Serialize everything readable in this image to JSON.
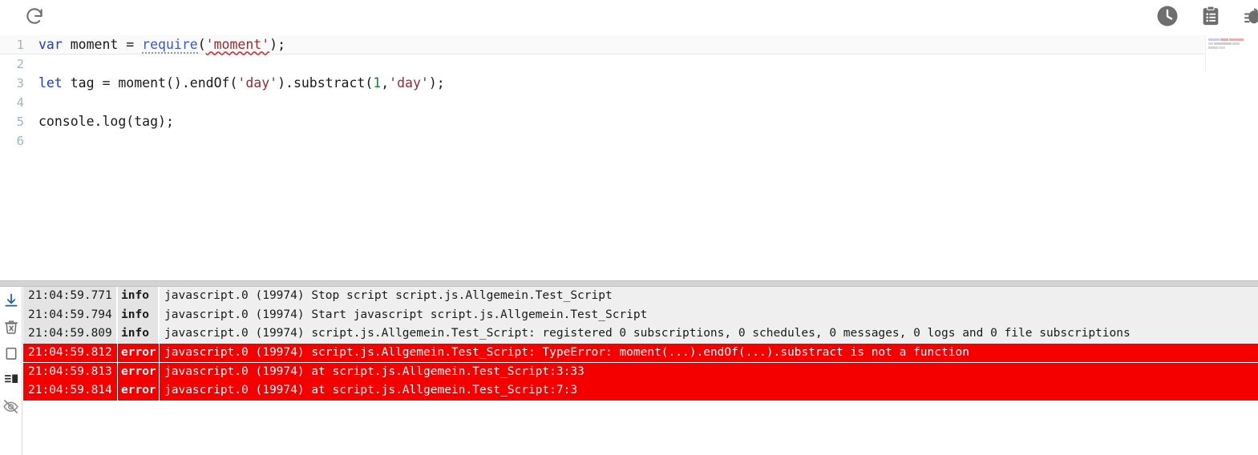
{
  "toolbar": {
    "left_icons": [
      {
        "name": "reload-icon",
        "label": "Reload"
      }
    ],
    "right_icons": [
      {
        "name": "clock-icon",
        "label": "Cron / Time"
      },
      {
        "name": "clipboard-icon",
        "label": "Script list"
      },
      {
        "name": "debug-bug-icon",
        "label": "Debug"
      }
    ]
  },
  "editor": {
    "language": "javascript",
    "active_line": 1,
    "lines": [
      {
        "number": "1",
        "active": true,
        "tokens": [
          {
            "t": "var",
            "c": "k-keyword"
          },
          {
            "t": " ",
            "c": "k-plain"
          },
          {
            "t": "moment",
            "c": "k-plain"
          },
          {
            "t": " = ",
            "c": "k-plain"
          },
          {
            "t": "require",
            "c": "k-fn dotted-under"
          },
          {
            "t": "(",
            "c": "k-punct"
          },
          {
            "t": "'moment'",
            "c": "k-string squiggle"
          },
          {
            "t": ")",
            "c": "k-punct"
          },
          {
            "t": ";",
            "c": "k-punct"
          }
        ]
      },
      {
        "number": "2",
        "active": false,
        "tokens": []
      },
      {
        "number": "3",
        "active": false,
        "tokens": [
          {
            "t": "let",
            "c": "k-keyword"
          },
          {
            "t": " tag = ",
            "c": "k-plain"
          },
          {
            "t": "moment",
            "c": "k-plain"
          },
          {
            "t": "().",
            "c": "k-punct"
          },
          {
            "t": "endOf",
            "c": "k-plain"
          },
          {
            "t": "(",
            "c": "k-punct"
          },
          {
            "t": "'day'",
            "c": "k-string"
          },
          {
            "t": ").",
            "c": "k-punct"
          },
          {
            "t": "substract",
            "c": "k-plain"
          },
          {
            "t": "(",
            "c": "k-punct"
          },
          {
            "t": "1",
            "c": "k-num"
          },
          {
            "t": ",",
            "c": "k-punct"
          },
          {
            "t": "'day'",
            "c": "k-string"
          },
          {
            "t": ")",
            "c": "k-punct"
          },
          {
            "t": ";",
            "c": "k-punct"
          }
        ]
      },
      {
        "number": "4",
        "active": false,
        "tokens": []
      },
      {
        "number": "5",
        "active": false,
        "tokens": [
          {
            "t": "console",
            "c": "k-plain"
          },
          {
            "t": ".",
            "c": "k-punct"
          },
          {
            "t": "log",
            "c": "k-plain"
          },
          {
            "t": "(",
            "c": "k-punct"
          },
          {
            "t": "tag",
            "c": "k-plain"
          },
          {
            "t": ")",
            "c": "k-punct"
          },
          {
            "t": ";",
            "c": "k-punct"
          }
        ]
      },
      {
        "number": "6",
        "active": false,
        "tokens": []
      }
    ],
    "minimap": {
      "rows": [
        [
          {
            "w": 14,
            "color": "#9aa7c8"
          },
          {
            "w": 10,
            "color": "#c26b6b"
          },
          {
            "w": 18,
            "color": "#d06f6f"
          }
        ],
        [
          {
            "w": 6,
            "color": "#bdbdbd"
          },
          {
            "w": 22,
            "color": "#a8a8a8"
          },
          {
            "w": 9,
            "color": "#b5b5b5"
          }
        ],
        [
          {
            "w": 12,
            "color": "#b0b0b0"
          },
          {
            "w": 8,
            "color": "#bfbfbf"
          }
        ]
      ]
    }
  },
  "log": {
    "sidebar_icons": [
      {
        "name": "scroll-to-bottom-icon",
        "label": "Scroll to bottom"
      },
      {
        "name": "delete-log-icon",
        "label": "Clear log"
      },
      {
        "name": "copy-log-icon",
        "label": "Copy log"
      },
      {
        "name": "layout-log-icon",
        "label": "Layout"
      },
      {
        "name": "hide-log-icon",
        "label": "Hide log"
      }
    ],
    "columns": [
      "timestamp",
      "severity",
      "message"
    ],
    "rows": [
      {
        "timestamp": "21:04:59.771",
        "severity": "info",
        "message": "javascript.0 (19974) Stop script script.js.Allgemein.Test_Script"
      },
      {
        "timestamp": "21:04:59.794",
        "severity": "info",
        "message": "javascript.0 (19974) Start javascript script.js.Allgemein.Test_Script"
      },
      {
        "timestamp": "21:04:59.809",
        "severity": "info",
        "message": "javascript.0 (19974) script.js.Allgemein.Test_Script: registered 0 subscriptions, 0 schedules, 0 messages, 0 logs and 0 file subscriptions"
      },
      {
        "timestamp": "21:04:59.812",
        "severity": "error",
        "message": "javascript.0 (19974) script.js.Allgemein.Test_Script: TypeError: moment(...).endOf(...).substract is not a function"
      },
      {
        "timestamp": "21:04:59.813",
        "severity": "error",
        "message": "javascript.0 (19974) at script.js.Allgemein.Test_Script:3:33"
      },
      {
        "timestamp": "21:04:59.814",
        "severity": "error",
        "message": "javascript.0 (19974) at script.js.Allgemein.Test_Script:7:3"
      }
    ]
  },
  "colors": {
    "error_bg": "#f40000",
    "info_bg": "#efefef",
    "accent_blue": "#1d3bd6",
    "gutter": "#9fb6c4",
    "splitter": "#d4d4d4"
  }
}
